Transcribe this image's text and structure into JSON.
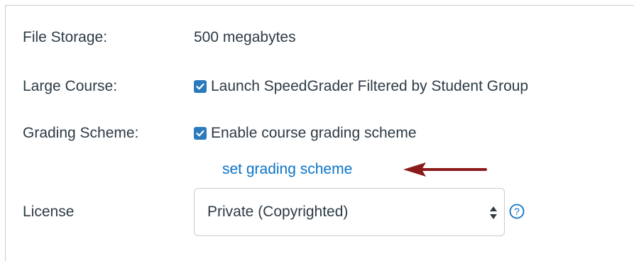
{
  "rows": {
    "file_storage": {
      "label": "File Storage:",
      "value": "500 megabytes"
    },
    "large_course": {
      "label": "Large Course:",
      "checkbox_label": "Launch SpeedGrader Filtered by Student Group",
      "checked": true
    },
    "grading_scheme": {
      "label": "Grading Scheme:",
      "checkbox_label": "Enable course grading scheme",
      "checked": true,
      "link": "set grading scheme"
    },
    "license": {
      "label": "License",
      "selected": "Private (Copyrighted)"
    }
  },
  "colors": {
    "text": "#2d3b45",
    "link": "#0b74c8",
    "checkbox": "#2b7abc",
    "annotation_arrow": "#8b1a1a",
    "border": "#c7cdd1"
  },
  "icons": {
    "checkbox": "checkmark-icon",
    "select_caret": "updown-caret-icon",
    "help": "help-circle-icon",
    "annotation": "left-arrow-icon"
  }
}
